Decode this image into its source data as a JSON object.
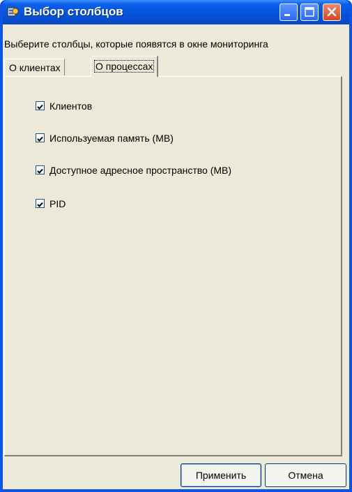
{
  "window": {
    "title": "Выбор столбцов",
    "icon": "app-icon"
  },
  "caption_buttons": {
    "minimize_icon": "minimize-icon",
    "maximize_icon": "maximize-icon",
    "close_icon": "close-icon"
  },
  "hint": "Выберите столбцы, которые появятся в окне мониторинга",
  "tabs": [
    {
      "label": "О клиентах",
      "active": false
    },
    {
      "label": "О процессах",
      "active": true
    }
  ],
  "checkboxes": [
    {
      "label": "Клиентов",
      "checked": true
    },
    {
      "label": "Используемая память (MB)",
      "checked": true
    },
    {
      "label": "Доступное адресное пространство (MB)",
      "checked": true
    },
    {
      "label": "PID",
      "checked": true
    }
  ],
  "buttons": {
    "apply": "Применить",
    "cancel": "Отмена"
  },
  "colors": {
    "titlebar": "#0553d8",
    "dialog_bg": "#ece9d8",
    "close_button": "#d54524",
    "checkmark": "#21a121"
  }
}
